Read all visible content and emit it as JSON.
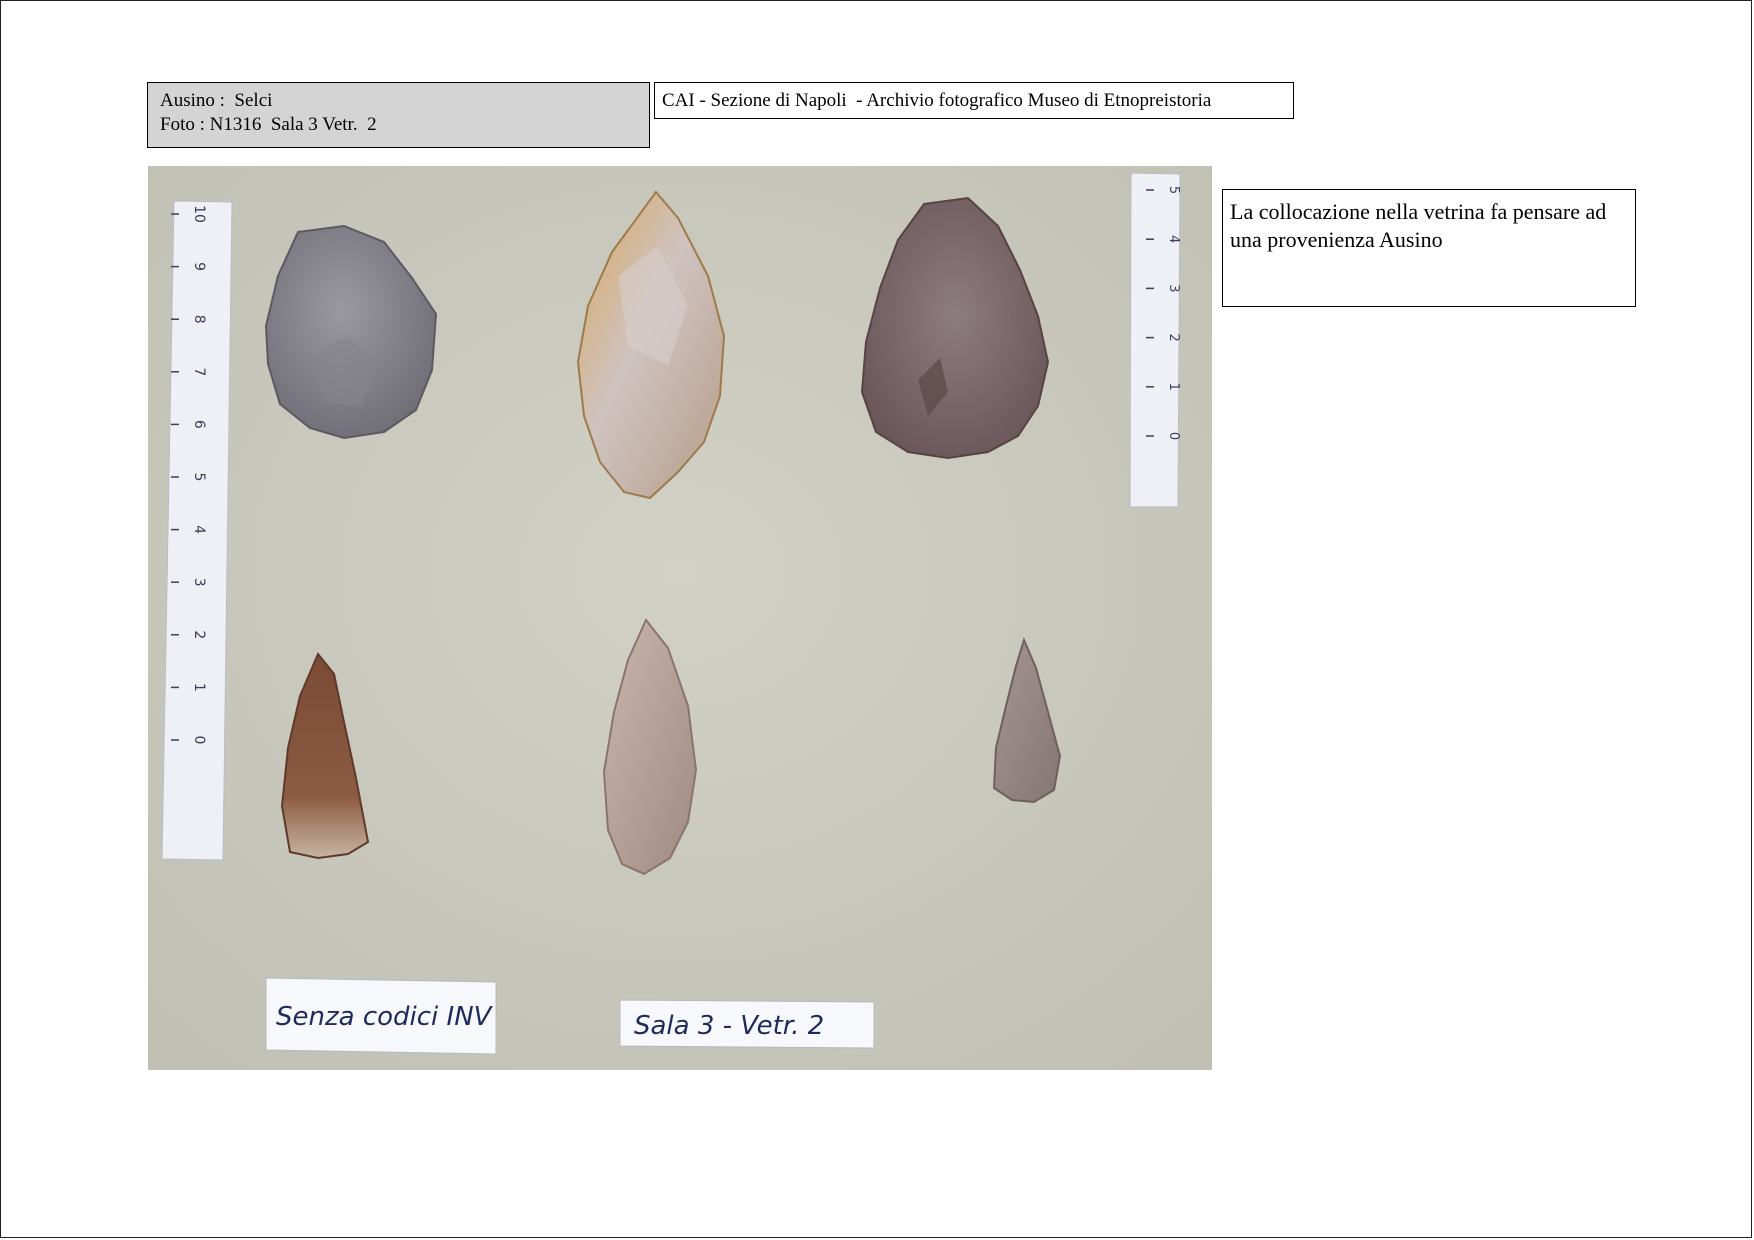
{
  "header": {
    "line1": "Ausino :  Selci",
    "line2": "Foto : N1316  Sala 3 Vetr.  2"
  },
  "archive_title": "CAI - Sezione di Napoli  - Archivio fotografico Museo di Etnopreistoria",
  "note": {
    "text": "La collocazione nella vetrina fa pensare ad una provenienza Ausino"
  },
  "photo": {
    "label_left": "Senza codici INV",
    "label_right": "Sala 3 - Vetr. 2",
    "ruler_left_numbers": [
      "10",
      "9",
      "8",
      "7",
      "6",
      "5",
      "4",
      "3",
      "2",
      "1",
      "0"
    ],
    "ruler_right_numbers": [
      "5",
      "4",
      "3",
      "2",
      "1",
      "0"
    ]
  }
}
